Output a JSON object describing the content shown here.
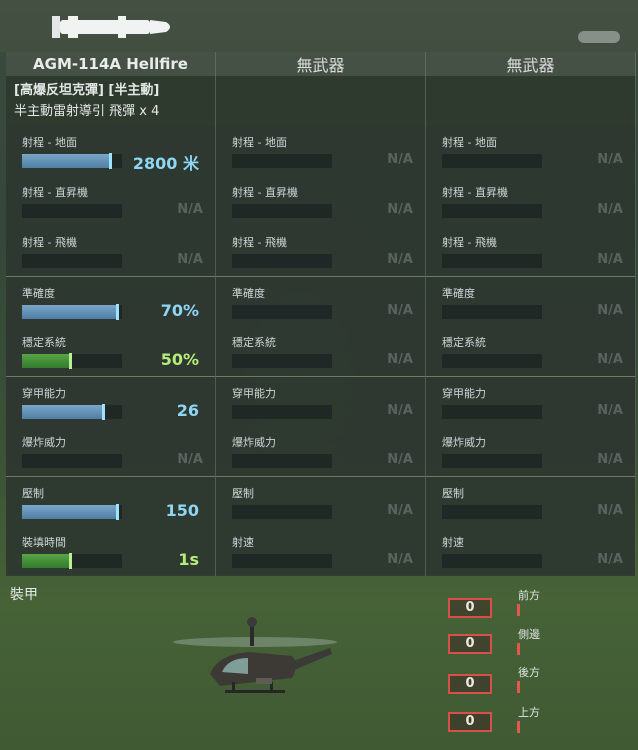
{
  "columns": [
    {
      "header": "AGM-114A Hellfire"
    },
    {
      "header": "無武器"
    },
    {
      "header": "無武器"
    }
  ],
  "weapon_info": {
    "line1": "[高爆反坦克彈] [半主動]",
    "line2": "半主動雷射導引 飛彈 x 4"
  },
  "na_text": "N/A",
  "stats": [
    {
      "label": "射程 - 地面",
      "value": "2800 米",
      "fill": 0.9,
      "color": "blue"
    },
    {
      "label": "射程 - 直昇機",
      "value": null
    },
    {
      "label": "射程 - 飛機",
      "value": null
    },
    {
      "label": "準確度",
      "value": "70%",
      "fill": 0.97,
      "color": "blue"
    },
    {
      "label": "穩定系統",
      "value": "50%",
      "fill": 0.5,
      "color": "green"
    },
    {
      "label": "穿甲能力",
      "value": "26",
      "fill": 0.83,
      "color": "blue"
    },
    {
      "label": "爆炸威力",
      "value": null
    },
    {
      "label": "壓制",
      "value": "150",
      "fill": 0.97,
      "color": "blue"
    },
    {
      "label": "裝填時間",
      "value": "1s",
      "fill": 0.5,
      "color": "green"
    }
  ],
  "other_labels": [
    "射程 - 地面",
    "射程 - 直昇機",
    "射程 - 飛機",
    "準確度",
    "穩定系統",
    "穿甲能力",
    "爆炸威力",
    "壓制",
    "射速"
  ],
  "armor": {
    "title": "裝甲",
    "items": [
      {
        "label": "前方",
        "value": "0"
      },
      {
        "label": "側邊",
        "value": "0"
      },
      {
        "label": "後方",
        "value": "0"
      },
      {
        "label": "上方",
        "value": "0"
      }
    ]
  },
  "colors": {
    "blue": "#4f7fa6",
    "green": "#327a2e",
    "accent_red": "#d8504a"
  }
}
